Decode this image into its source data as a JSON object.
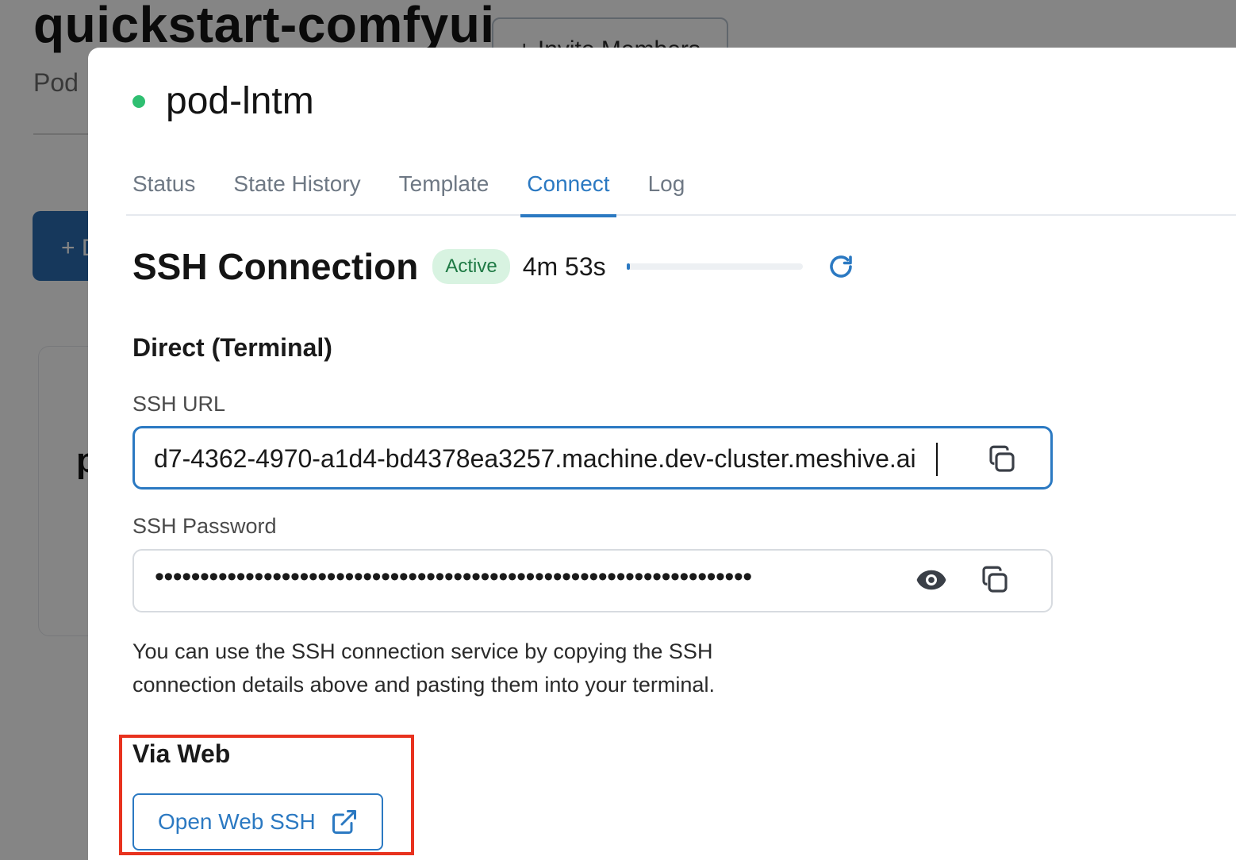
{
  "background": {
    "title": "quickstart-comfyui",
    "invite_label": "+ Invite Members",
    "subtitle": "Pod",
    "add_button_label": "+ D",
    "card_letter": "p"
  },
  "pod": {
    "name": "pod-lntm",
    "status_color": "#2fbf71"
  },
  "tabs": [
    {
      "label": "Status",
      "active": false
    },
    {
      "label": "State History",
      "active": false
    },
    {
      "label": "Template",
      "active": false
    },
    {
      "label": "Connect",
      "active": true
    },
    {
      "label": "Log",
      "active": false
    }
  ],
  "ssh": {
    "title": "SSH Connection",
    "badge": "Active",
    "time_remaining": "4m 53s",
    "progress_fraction": 0.02,
    "refresh_icon": "refresh-icon"
  },
  "direct": {
    "heading": "Direct (Terminal)",
    "url_label": "SSH URL",
    "url_value": "d7-4362-4970-a1d4-bd4378ea3257.machine.dev-cluster.meshive.ai",
    "password_label": "SSH Password",
    "password_masked": "••••••••••••••••••••••••••••••••••••••••••••••••••••••••••••••••••",
    "help_text": "You can use the SSH connection service by copying the SSH connection details above and pasting them into your terminal."
  },
  "web": {
    "heading": "Via Web",
    "button_label": "Open Web SSH",
    "button_icon": "external-link-icon"
  },
  "colors": {
    "accent": "#2b79c2",
    "active_badge_bg": "#d8f3e1",
    "highlight": "#e8321e"
  }
}
